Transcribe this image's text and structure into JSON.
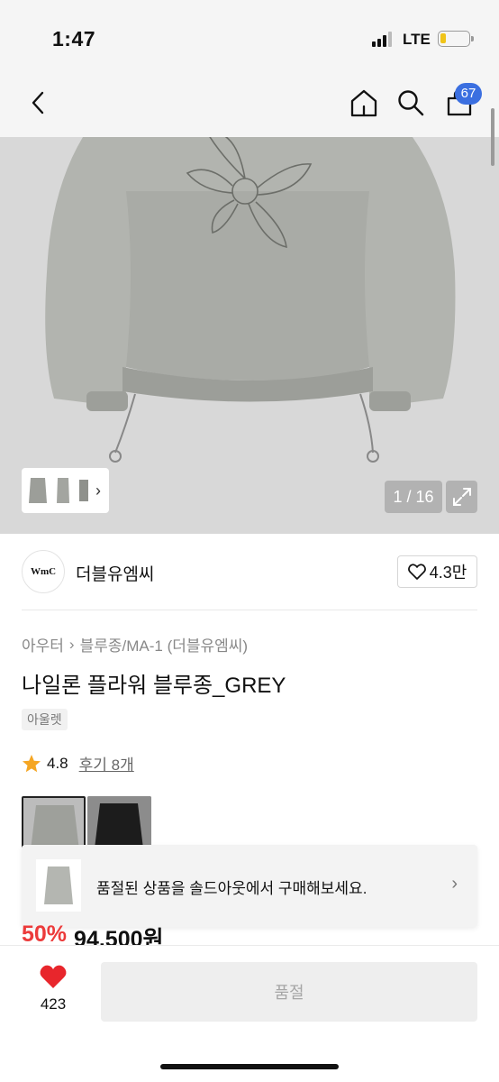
{
  "status_bar": {
    "time": "1:47",
    "network": "LTE",
    "battery_color": "#f0c419"
  },
  "top_nav": {
    "cart_count": "67"
  },
  "hero": {
    "page_counter": "1 / 16"
  },
  "brand": {
    "logo_text": "WmC",
    "name": "더블유엠씨",
    "likes": "4.3만"
  },
  "breadcrumb": {
    "category": "아우터",
    "subcategory": "블루종/MA-1 (더블유엠씨)"
  },
  "product": {
    "title": "나일론 플라워 블루종_GREY",
    "tag": "아울렛",
    "rating": "4.8",
    "reviews": "후기 8개",
    "variants": [
      "GREY",
      "BLACK"
    ]
  },
  "soldout_banner": {
    "text": "품절된 상품을 솔드아웃에서 구매해보세요."
  },
  "price": {
    "discount": "50%",
    "amount": "94.500원"
  },
  "bottom_bar": {
    "wish_count": "423",
    "buy_label": "품절"
  },
  "colors": {
    "accent_blue": "#3b6fe0",
    "discount_red": "#ec3b3b",
    "heart_red": "#e8262c"
  }
}
